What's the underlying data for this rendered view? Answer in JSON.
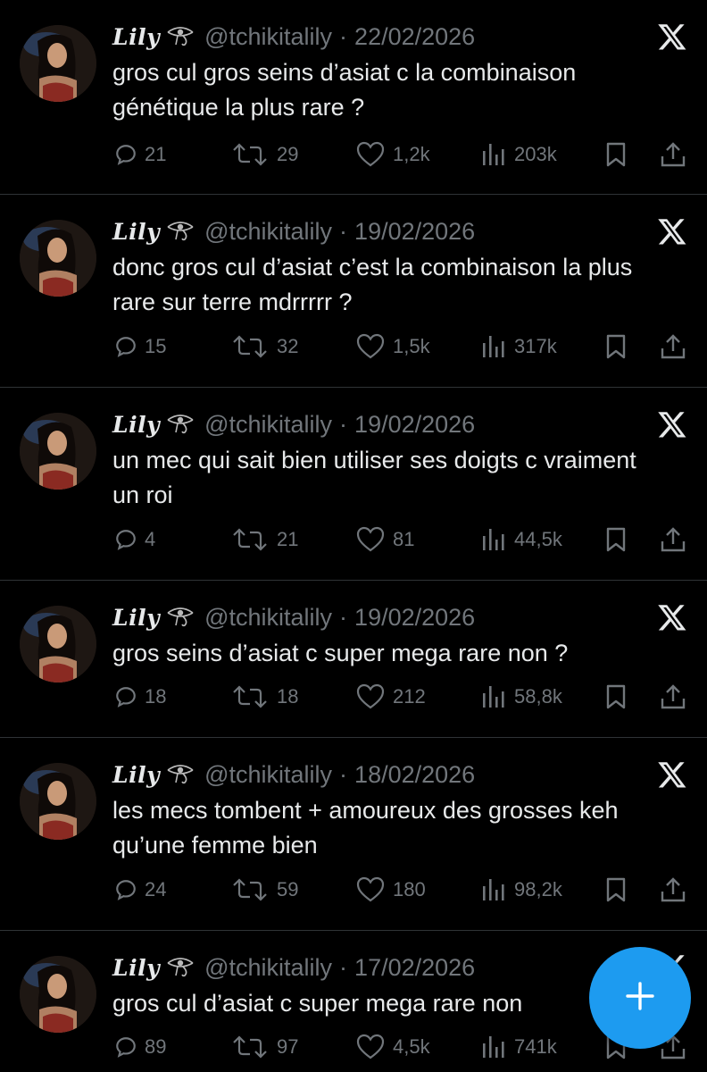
{
  "feed": {
    "tweets": [
      {
        "name": "Lily",
        "handle": "@tchikitalily",
        "sep": "·",
        "date": "22/02/2026",
        "text": "gros cul gros seins d’asiat c la combinaison génétique la plus rare ?",
        "replies": "21",
        "reposts": "29",
        "likes": "1,2k",
        "views": "203k"
      },
      {
        "name": "Lily",
        "handle": "@tchikitalily",
        "sep": "·",
        "date": "19/02/2026",
        "text": "donc gros cul d’asiat c’est la combinaison la plus rare sur terre mdrrrrr ?",
        "replies": "15",
        "reposts": "32",
        "likes": "1,5k",
        "views": "317k"
      },
      {
        "name": "Lily",
        "handle": "@tchikitalily",
        "sep": "·",
        "date": "19/02/2026",
        "text": "un mec qui sait bien utiliser ses doigts c vraiment un roi",
        "replies": "4",
        "reposts": "21",
        "likes": "81",
        "views": "44,5k"
      },
      {
        "name": "Lily",
        "handle": "@tchikitalily",
        "sep": "·",
        "date": "19/02/2026",
        "text": "gros seins d’asiat c super mega rare non ?",
        "replies": "18",
        "reposts": "18",
        "likes": "212",
        "views": "58,8k"
      },
      {
        "name": "Lily",
        "handle": "@tchikitalily",
        "sep": "·",
        "date": "18/02/2026",
        "text": "les mecs tombent + amoureux des grosses keh qu’une femme bien",
        "replies": "24",
        "reposts": "59",
        "likes": "180",
        "views": "98,2k"
      },
      {
        "name": "Lily",
        "handle": "@tchikitalily",
        "sep": "·",
        "date": "17/02/2026",
        "text": "gros cul d’asiat c super mega rare non",
        "replies": "89",
        "reposts": "97",
        "likes": "4,5k",
        "views": "741k"
      }
    ]
  },
  "icons": {
    "reply": "reply-icon",
    "repost": "repost-icon",
    "like": "heart-icon",
    "views": "views-icon",
    "bookmark": "bookmark-icon",
    "share": "share-icon",
    "x_logo": "x-logo-icon",
    "compose": "plus-icon"
  },
  "colors": {
    "background": "#000000",
    "text": "#e7e9ea",
    "muted": "#71767b",
    "accent": "#1d9bf0",
    "divider": "#2f3336"
  }
}
